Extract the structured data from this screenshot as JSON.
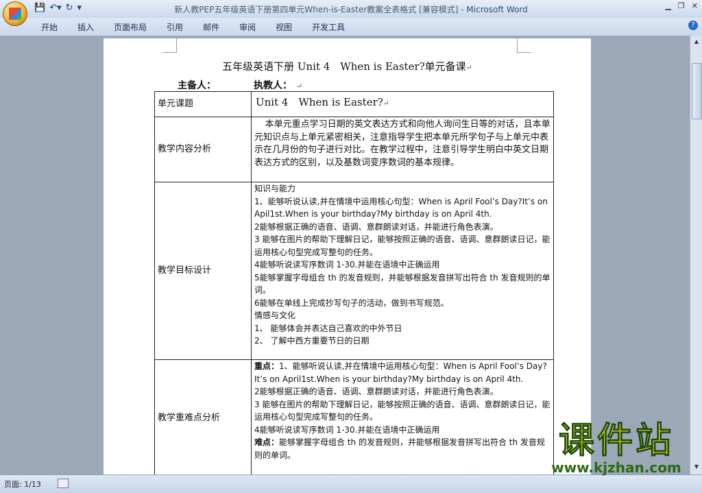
{
  "window": {
    "title": "新人教PEP五年级英语下册第四单元When-is-Easter教案全表格式 [兼容模式]",
    "app_name": "Microsoft Word",
    "separator": " - "
  },
  "ribbon": {
    "tabs": [
      "开始",
      "插入",
      "页面布局",
      "引用",
      "邮件",
      "审阅",
      "视图",
      "开发工具"
    ]
  },
  "document": {
    "title": "五年级英语下册 Unit 4　When is Easter?单元备课",
    "preparer_label": "主备人：",
    "teacher_label": "执教人：",
    "rows": [
      {
        "label": "单元课题",
        "lines": [
          "Unit 4　When is Easter?"
        ]
      },
      {
        "label": "教学内容分析",
        "lines": [
          "本单元重点学习日期的英文表达方式和向他人询问生日等的对话，且本单元知识点与上单元紧密相关，注意指导学生把本单元所学句子与上单元中表示在几月份的句子进行对比。在教学过程中，注意引导学生明白中英文日期表达方式的区别，以及基数词变序数词的基本规律。"
        ]
      },
      {
        "label": "教学目标设计",
        "lines": [
          "知识与能力",
          "1、能够听说认读,并在情境中运用核心句型：When is April Fool’s Day?It’s on Apil1st.When is your birthday?My birthday is on April 4th.",
          "2能够根据正确的语音、语调、意群朗读对话，并能进行角色表演。",
          "3 能够在图片的帮助下理解日记，能够按照正确的语音、语调、意群朗读日记，能运用核心句型完成写整句的任务。",
          "4能够听说读写序数词 1-30.并能在语境中正确运用",
          "5能够掌握字母组合 th 的发音规则，并能够根据发音拼写出符合 th 发音规则的单词。",
          "6能够在单线上完成抄写句子的活动，做到书写规范。",
          "情感与文化",
          "1、 能够体会并表达自己喜欢的中外节日",
          "2、 了解中西方重要节日的日期"
        ]
      },
      {
        "label": "教学重难点分析",
        "key_label": "重点：",
        "difficult_label": "难点：",
        "lines": [
          "1、能够听说认读,并在情境中运用核心句型：When is April Fool’s Day?It’s on April1st.When is your birthday?My birthday is on April 4th.",
          "2能够根据正确的语音、语调、意群朗读对话，并能进行角色表演。",
          "3 能够在图片的帮助下理解日记，能够按照正确的语音、语调、意群朗读日记，能运用核心句型完成写整句的任务。",
          "4能够听说读写序数词 1-30.并能在语境中正确运用",
          "能够掌握字母组合 th 的发音规则，并能够根据发音拼写出符合 th 发音规则的单词。"
        ]
      }
    ]
  },
  "status_bar": {
    "page": "页面: 1/13"
  },
  "watermark": {
    "name": "课件站",
    "url": "www.kjzhan.com"
  },
  "icons": [
    "office-button-icon",
    "save-icon",
    "undo-icon",
    "redo-icon",
    "customize-qat-icon",
    "minimize-icon",
    "restore-icon",
    "close-icon",
    "help-icon",
    "paragraph-mark-icon",
    "scroll-up-icon",
    "scroll-down-icon"
  ]
}
